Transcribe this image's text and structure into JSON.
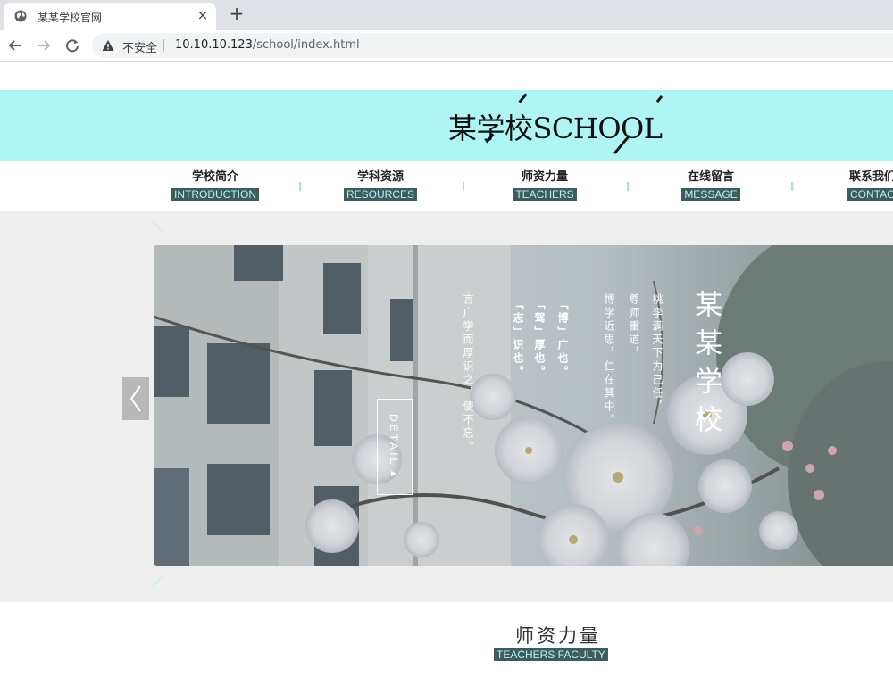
{
  "browser": {
    "tab_title": "某某学校官网",
    "tab_close": "×",
    "new_tab": "+",
    "security_label": "不安全",
    "separator": "|",
    "url_host": "10.10.10.123",
    "url_path": "/school/index.html",
    "icons": [
      "globe-icon",
      "close-icon",
      "plus-icon",
      "back-icon",
      "forward-icon",
      "reload-icon",
      "warning-icon"
    ]
  },
  "site": {
    "logo_text": "某学校SCHOOL",
    "accent_color": "#b0f5f5",
    "label_bg_color": "#3f5b5b"
  },
  "nav": {
    "items": [
      {
        "cn": "学校简介",
        "en": "INTRODUCTION"
      },
      {
        "cn": "学科资源",
        "en": "RESOURCES"
      },
      {
        "cn": "师资力量",
        "en": "TEACHERS"
      },
      {
        "cn": "在线留言",
        "en": "MESSAGE"
      },
      {
        "cn": "联系我们",
        "en": "CONTACT"
      }
    ]
  },
  "hero": {
    "title": "某某学校",
    "lines": [
      "桃李满天下为己任，",
      "尊师重道，",
      "博学近思，仁在其中。",
      "「博」广也。",
      "「驾」厚也。",
      "「志」识也。",
      "言广学而厚识之，使不忘。"
    ],
    "detail_label": "DETAIL▸",
    "prev_arrow": "‹"
  },
  "section": {
    "title": "师资力量",
    "subtitle": "TEACHERS FACULTY"
  }
}
